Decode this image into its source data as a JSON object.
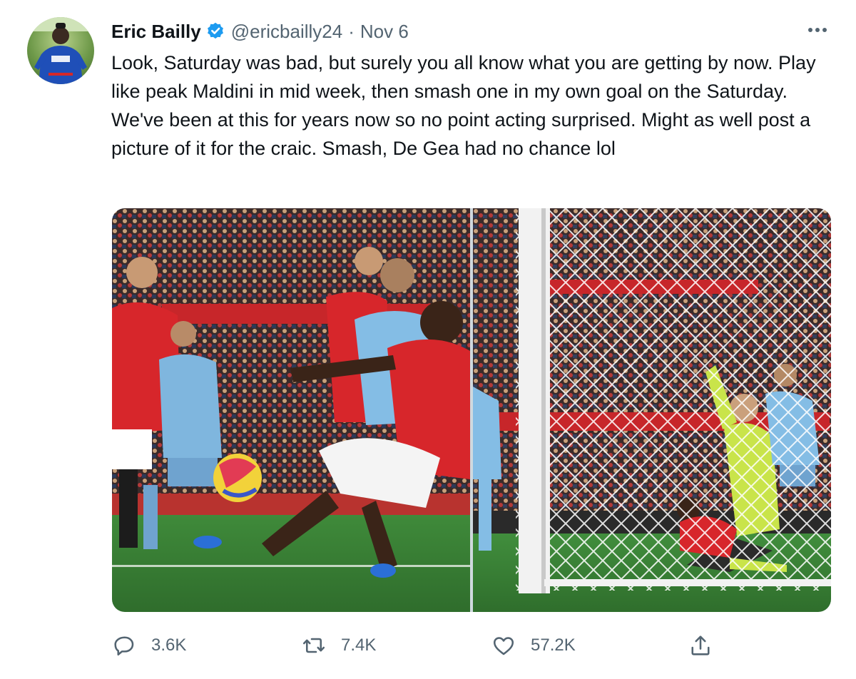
{
  "tweet": {
    "author": {
      "display_name": "Eric Bailly",
      "handle": "@ericbailly24",
      "verified": true,
      "avatar_icon": "user-avatar"
    },
    "separator": "·",
    "date": "Nov 6",
    "text": "Look, Saturday was bad, but surely you all know what you are getting by now. Play like peak Maldini in mid week, then smash one in my own goal on the Saturday. We've been at this for years now so no point acting surprised. Might as well post a picture of it for the craic. Smash, De Gea had no chance lol",
    "media": [
      {
        "icon": "photo"
      },
      {
        "icon": "photo"
      }
    ],
    "actions": {
      "reply": {
        "icon": "reply-icon",
        "count": "3.6K"
      },
      "retweet": {
        "icon": "retweet-icon",
        "count": "7.4K"
      },
      "like": {
        "icon": "heart-icon",
        "count": "57.2K"
      },
      "share": {
        "icon": "share-icon"
      }
    }
  },
  "colors": {
    "text": "#0f1419",
    "secondary": "#536471",
    "verified": "#1d9bf0",
    "background": "#ffffff"
  }
}
